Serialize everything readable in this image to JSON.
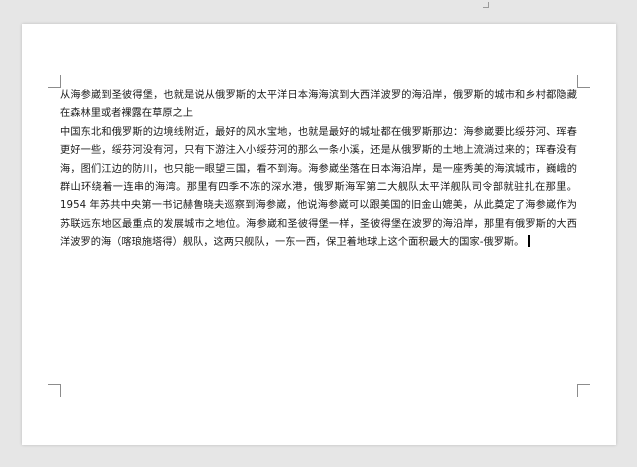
{
  "document": {
    "paragraphs": [
      "从海参崴到圣彼得堡，也就是说从俄罗斯的太平洋日本海海滨到大西洋波罗的海沿岸，俄罗斯的城市和乡村都隐藏在森林里或者裸露在草原之上",
      "中国东北和俄罗斯的边境线附近，最好的风水宝地，也就是最好的城址都在俄罗斯那边：海参崴要比绥芬河、珲春更好一些，绥芬河没有河，只有下游注入小绥芬河的那么一条小溪，还是从俄罗斯的土地上流淌过来的；珲春没有海，图们江边的防川，也只能一眼望三国，看不到海。海参崴坐落在日本海沿岸，是一座秀美的海滨城市，巍峨的群山环绕着一连串的海湾。那里有四季不冻的深水港，俄罗斯海军第二大舰队太平洋舰队司令部就驻扎在那里。1954 年苏共中央第一书记赫鲁晓夫巡察到海参崴，他说海参崴可以跟美国的旧金山媲美，从此奠定了海参崴作为苏联远东地区最重点的发展城市之地位。海参崴和圣彼得堡一样，圣彼得堡在波罗的海沿岸，那里有俄罗斯的大西洋波罗的海（喀琅施塔得）舰队，这两只舰队，一东一西，保卫着地球上这个面积最大的国家-俄罗斯。"
    ]
  }
}
